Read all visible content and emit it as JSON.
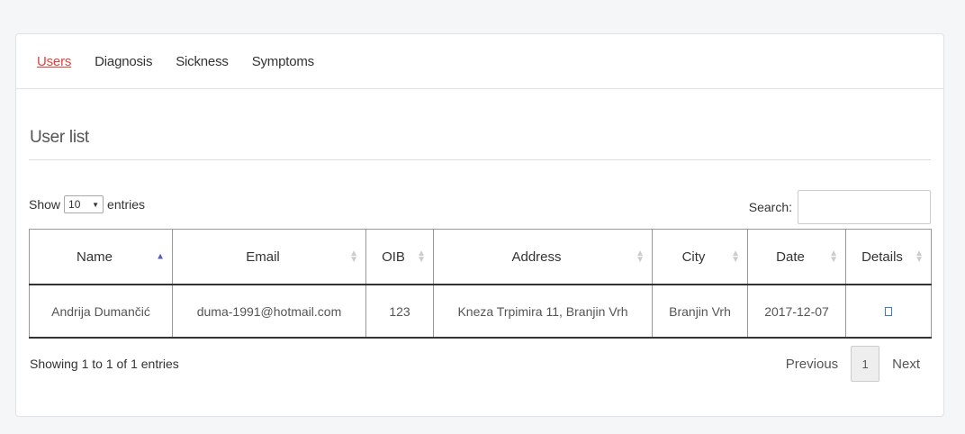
{
  "nav": {
    "tabs": [
      {
        "label": "Users"
      },
      {
        "label": "Diagnosis"
      },
      {
        "label": "Sickness"
      },
      {
        "label": "Symptoms"
      }
    ]
  },
  "page_title": "User list",
  "length_control": {
    "prefix": "Show",
    "value": "10",
    "suffix": "entries"
  },
  "search": {
    "label": "Search:",
    "value": ""
  },
  "table": {
    "headers": [
      "Name",
      "Email",
      "OIB",
      "Address",
      "City",
      "Date",
      "Details"
    ],
    "rows": [
      [
        "Andrija Dumančić",
        "duma-1991@hotmail.com",
        "123",
        "Kneza Trpimira 11, Branjin Vrh",
        "Branjin Vrh",
        "2017-12-07"
      ]
    ]
  },
  "footer": {
    "info": "Showing 1 to 1 of 1 entries",
    "previous": "Previous",
    "page": "1",
    "next": "Next"
  },
  "colors": {
    "active_tab": "#e8403b",
    "sort_asc": "#5a5fb5",
    "detail_icon": "#3a7bd5"
  }
}
